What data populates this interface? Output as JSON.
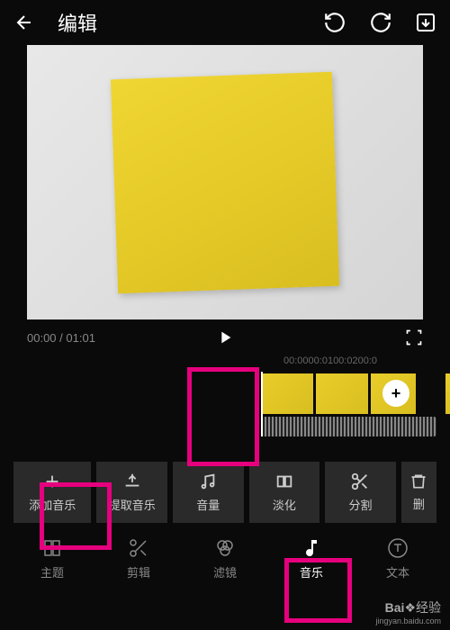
{
  "header": {
    "title": "编辑"
  },
  "time": {
    "current": "00:00",
    "total": "01:01"
  },
  "ruler": {
    "t0": "00:00",
    "t1": "00:01",
    "t2": "00:02",
    "t3": "00:0"
  },
  "toolbar": {
    "add_music": "添加音乐",
    "extract_music": "提取音乐",
    "volume": "音量",
    "fade": "淡化",
    "split": "分割",
    "delete": "删"
  },
  "nav": {
    "theme": "主题",
    "edit": "剪辑",
    "filter": "滤镜",
    "music": "音乐",
    "text": "文本"
  },
  "watermark": {
    "brand": "Bai",
    "brand2": "经验",
    "url": "jingyan.baidu.com"
  }
}
